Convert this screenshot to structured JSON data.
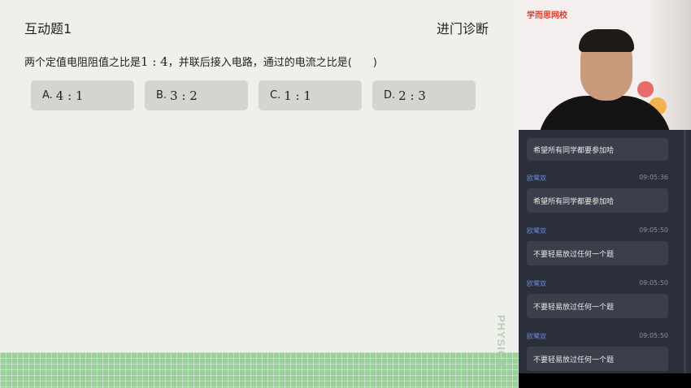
{
  "slide": {
    "title": "互动题1",
    "subtitle": "进门诊断",
    "question": {
      "prefix": "两个定值电阻阻值之比是",
      "ratio": "1 : 4",
      "suffix": "，并联后接入电路，通过的电流之比是(　　)"
    },
    "options": [
      {
        "letter": "A.",
        "value": "4 : 1"
      },
      {
        "letter": "B.",
        "value": "3 : 2"
      },
      {
        "letter": "C.",
        "value": "1 : 1"
      },
      {
        "letter": "D.",
        "value": "2 : 3"
      }
    ],
    "watermark": "PHYSICS"
  },
  "video": {
    "brand": "学而思网校"
  },
  "chat": {
    "partial_message": "希望所有同学都要参加哈",
    "messages": [
      {
        "name": "欧鹭双",
        "time": "09:05:36",
        "text": "希望所有同学都要参加哈"
      },
      {
        "name": "欧鹭双",
        "time": "09:05:50",
        "text": "不要轻易放过任何一个题"
      },
      {
        "name": "欧鹭双",
        "time": "09:05:50",
        "text": "不要轻易放过任何一个题"
      },
      {
        "name": "欧鹭双",
        "time": "09:05:50",
        "text": "不要轻易放过任何一个题"
      }
    ]
  },
  "colors": {
    "slide_bg": "#efefec",
    "option_bg": "#d4d4d1",
    "grid_band": "#9bcf9b",
    "panel_bg": "#2b2f3a",
    "chat_name": "#6b8be0",
    "brand": "#e23a2c"
  }
}
